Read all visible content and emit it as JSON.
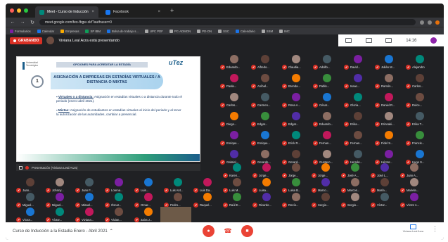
{
  "browser": {
    "tabs": [
      {
        "label": "Meet - Curso de Inducción"
      },
      {
        "label": "Facebook"
      }
    ],
    "url": "meet.google.com/feo-fbgw-xkf?authuser=0",
    "bookmarks": [
      "Formularios",
      "Calendar",
      "Empresas",
      "SP IBM",
      "Bolsa de trabajo s...",
      "UPC PDF",
      "PC-ADMON",
      "PD-ON",
      "SSC",
      "Calendario",
      "SSM",
      "IMC"
    ]
  },
  "meet": {
    "recording_label": "GRABANDO",
    "presenting_text": "Viviana Leal Arza está presentando",
    "time": "14:16",
    "presentation_label": "Presentación (Viviana Leal Arza)",
    "meeting_title": "Curso de Inducción a la Estadía Enero - Abril 2021",
    "present_button": "Viviana Leal Arza"
  },
  "slide": {
    "header": "OPCIONES PARA ACREDITAR LA ESTADÍA",
    "left_logo": "Universidad Tecnológica",
    "right_logo": "uTez",
    "number": "1",
    "title": "ASIGNACIÓN A EMPRESAS EN ESTADÍAS VIRTUALES / A DISTANCIA O MIXTAS",
    "bullet1_term": "Virtuales o a distancia:",
    "bullet1_text": "Asignación en estadías virtuales o a distancia durante todo el periodo (enero-abril 2021).",
    "bullet2_term": "Mixtas:",
    "bullet2_text": "Asignación de estudiantes en estadías virtuales al inicio del periodo y al tener la autorización de las autoridades, cambiar a presencial."
  },
  "participants": [
    "Eduardo...",
    "Alfredo...",
    "Claudia...",
    "Adolfo...",
    "David...",
    "Julián M...",
    "Alejandro",
    "Paola...",
    "Aníbal...",
    "Brenda...",
    "Pablo...",
    "Isaac...",
    "Ramón...",
    "Carlos...",
    "Carlos...",
    "Carmen...",
    "Rosa A...",
    "César...",
    "Gloria...",
    "Daniel R...",
    "Dulce...",
    "Diego...",
    "Edgar...",
    "Edgar...",
    "Eduardo...",
    "Erika...",
    "Erinnaki...",
    "Erika T...",
    "Enrique...",
    "Enrique...",
    "Erick R...",
    "Fernan...",
    "Fernan...",
    "Fidel S...",
    "Francis...",
    "Gabriel...",
    "Gerardo...",
    "Gerard...",
    "Gustavo...",
    "Hernán...",
    "Héctor...",
    "Hugo S...",
    "Karen...",
    "Jorge...",
    "Jorge...",
    "Jorge...",
    "José A...",
    "José L...",
    "Juan A...",
    "Juan...",
    "Johnny...",
    "Juan F...",
    "Lorena...",
    "Luis...",
    "Luis Ant...",
    "Luis Da...",
    "Luis M...",
    "Luisa...",
    "Luisa B...",
    "Marco...",
    "Marcos...",
    "María...",
    "Mariela...",
    "Miguel...",
    "Miguel...",
    "Misael...",
    "Óscar...",
    "Omar...",
    "Pedro...",
    "Raquel...",
    "Raúl E...",
    "Ricardo...",
    "Rocío...",
    "Sergio...",
    "Sergio...",
    "Víctor...",
    "Víctor A...",
    "Víctor...",
    "Víctor...",
    "Viviana...",
    "Vivian...",
    "Zaira J..."
  ],
  "colors": {
    "record_red": "#d93025",
    "meet_dark": "#202124"
  }
}
